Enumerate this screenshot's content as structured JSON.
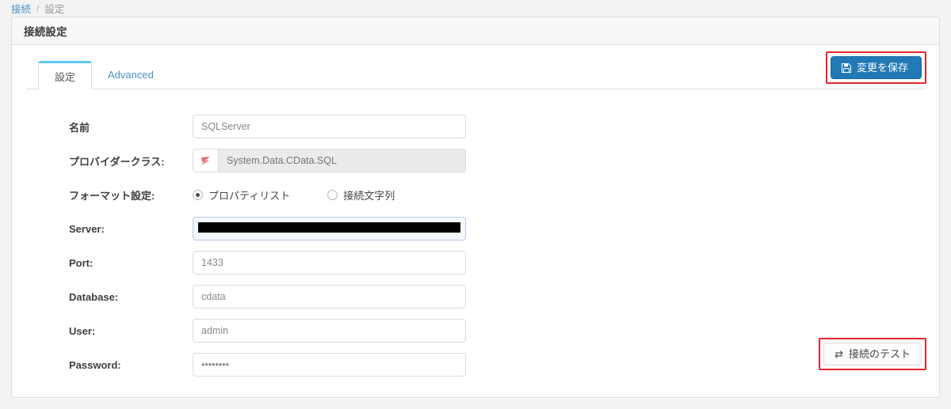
{
  "breadcrumb": {
    "root_label": "接続",
    "separator": "/",
    "current_label": "設定"
  },
  "panel": {
    "title": "接続設定"
  },
  "tabs": [
    {
      "label": "設定",
      "active": true
    },
    {
      "label": "Advanced",
      "active": false
    }
  ],
  "toolbar": {
    "save_label": "変更を保存",
    "save_icon": "save-floppy-icon",
    "save_bg_color": "#2179b5",
    "annotation_color": "#e8262b"
  },
  "form": {
    "rows": [
      {
        "label": "名前",
        "type": "text",
        "value": "SQLServer"
      },
      {
        "label": "プロバイダークラス:",
        "type": "input-group-disabled",
        "addon_icon": "cdata-logo-icon",
        "value": "System.Data.CData.SQL"
      },
      {
        "label": "フォーマット設定:",
        "type": "radio",
        "options": [
          {
            "label": "プロパティリスト",
            "checked": true
          },
          {
            "label": "接続文字列",
            "checked": false
          }
        ]
      },
      {
        "label": "Server:",
        "type": "redacted",
        "value": ""
      },
      {
        "label": "Port:",
        "type": "text",
        "value": "1433"
      },
      {
        "label": "Database:",
        "type": "text",
        "value": "cdata"
      },
      {
        "label": "User:",
        "type": "text",
        "value": "admin"
      },
      {
        "label": "Password:",
        "type": "password",
        "value": "••••••••"
      }
    ]
  },
  "footer": {
    "test_label": "接続のテスト",
    "test_icon": "swap-arrows-icon"
  }
}
